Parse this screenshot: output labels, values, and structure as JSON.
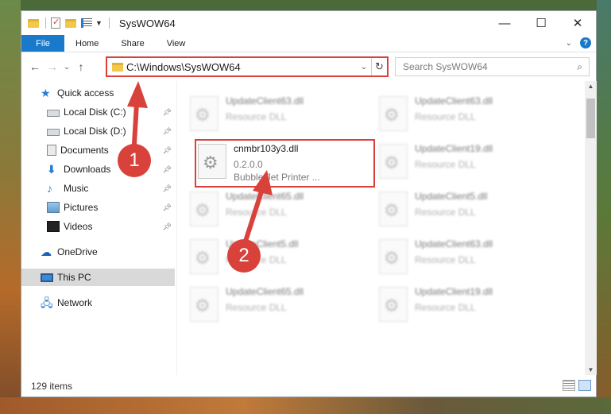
{
  "window": {
    "title": "SysWOW64",
    "controls": {
      "minimize": "—",
      "maximize": "☐",
      "close": "✕"
    }
  },
  "ribbon": {
    "tabs": [
      "File",
      "Home",
      "Share",
      "View"
    ],
    "expand_icon": "chevron-down-icon",
    "help": "?"
  },
  "address": {
    "path": "C:\\Windows\\SysWOW64",
    "search_placeholder": "Search SysWOW64"
  },
  "nav": {
    "quick_access": "Quick access",
    "items": [
      {
        "label": "Local Disk (C:)",
        "icon": "disk-icon",
        "pinned": true
      },
      {
        "label": "Local Disk (D:)",
        "icon": "disk-icon",
        "pinned": true
      },
      {
        "label": "Documents",
        "icon": "documents-icon",
        "pinned": true
      },
      {
        "label": "Downloads",
        "icon": "download-icon",
        "pinned": true
      },
      {
        "label": "Music",
        "icon": "music-icon",
        "pinned": true
      },
      {
        "label": "Pictures",
        "icon": "pictures-icon",
        "pinned": true
      },
      {
        "label": "Videos",
        "icon": "videos-icon",
        "pinned": true
      }
    ],
    "onedrive": "OneDrive",
    "this_pc": "This PC",
    "network": "Network"
  },
  "files": {
    "selected": {
      "name": "cnmbr103y3.dll",
      "version": "0.2.0.0",
      "description": "Bubble Jet Printer ..."
    },
    "background": [
      {
        "name": "UpdateClient63.dll",
        "type": "Resource DLL"
      },
      {
        "name": "UpdateClient63.dll",
        "type": "Resource DLL"
      },
      {
        "name": "UpdateClient19.dll",
        "type": "Resource DLL"
      },
      {
        "name": "UpdateClient65.dll",
        "type": "Resource DLL"
      },
      {
        "name": "UpdateClient5.dll",
        "type": "Resource DLL"
      },
      {
        "name": "UpdateClient5.dll",
        "type": "Resource DLL"
      },
      {
        "name": "UpdateClient63.dll",
        "type": "Resource DLL"
      },
      {
        "name": "UpdateClient65.dll",
        "type": "Resource DLL"
      },
      {
        "name": "UpdateClient19.dll",
        "type": "Resource DLL"
      }
    ]
  },
  "status": {
    "item_count": "129 items"
  },
  "annotations": {
    "step1": "1",
    "step2": "2",
    "accent_color": "#d9413b"
  }
}
